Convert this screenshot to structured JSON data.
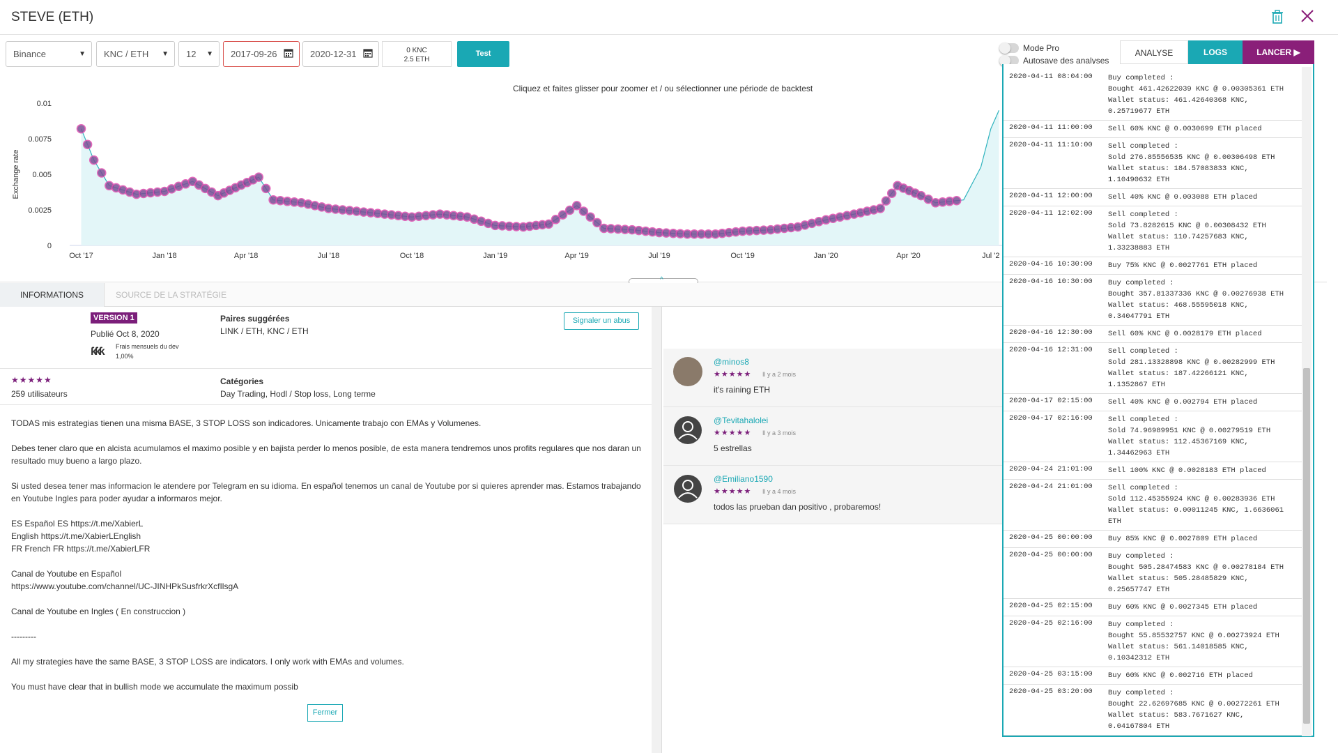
{
  "header": {
    "title": "STEVE (ETH)"
  },
  "toolbar": {
    "exchange": "Binance",
    "pair": "KNC / ETH",
    "interval": "12",
    "start_date": "2017-09-26",
    "end_date": "2020-12-31",
    "wallet_line1": "0 KNC",
    "wallet_line2": "2.5 ETH",
    "test_label": "Test",
    "mode_pro_label": "Mode Pro",
    "autosave_label": "Autosave des analyses",
    "mode_pro_on": false,
    "autosave_on": false,
    "tab_analyse": "ANALYSE",
    "tab_logs": "LOGS",
    "tab_launch": "LANCER ▶"
  },
  "chart": {
    "hint": "Cliquez et faites glisser pour zoomer et / ou sélectionner une période de backtest",
    "colors": {
      "line": "#2fb3be",
      "fill": "#e3f6f8",
      "marker": "#7b4e95",
      "marker_ring": "#e04db0"
    }
  },
  "chart_data": {
    "type": "area",
    "ylabel": "Exchange rate",
    "ylim": [
      0,
      0.01
    ],
    "yticks": [
      "0",
      "0.0025",
      "0.005",
      "0.0075",
      "0.01"
    ],
    "xticks": [
      "Oct '17",
      "Jan '18",
      "Apr '18",
      "Jul '18",
      "Oct '18",
      "Jan '19",
      "Apr '19",
      "Jul '19",
      "Oct '19",
      "Jan '20",
      "Apr '20",
      "Jul '2"
    ],
    "x_dates": [
      "2017-10-01",
      "2017-10-15",
      "2017-11-01",
      "2017-12-01",
      "2018-01-01",
      "2018-02-01",
      "2018-03-01",
      "2018-04-15",
      "2018-05-01",
      "2018-06-01",
      "2018-07-01",
      "2018-08-01",
      "2018-09-01",
      "2018-10-01",
      "2018-11-01",
      "2018-12-01",
      "2019-01-01",
      "2019-02-01",
      "2019-03-01",
      "2019-04-01",
      "2019-05-01",
      "2019-06-01",
      "2019-07-01",
      "2019-08-01",
      "2019-09-01",
      "2019-10-01",
      "2019-11-01",
      "2019-12-01",
      "2020-01-01",
      "2020-02-01",
      "2020-03-01",
      "2020-03-20",
      "2020-04-15",
      "2020-05-01",
      "2020-06-01",
      "2020-06-20",
      "2020-07-01",
      "2020-07-10"
    ],
    "values": [
      0.0082,
      0.006,
      0.0042,
      0.0036,
      0.0038,
      0.0045,
      0.0035,
      0.0048,
      0.0032,
      0.003,
      0.0026,
      0.0024,
      0.0022,
      0.002,
      0.0022,
      0.002,
      0.0014,
      0.0013,
      0.0015,
      0.0028,
      0.0012,
      0.0011,
      0.0009,
      0.0008,
      0.0008,
      0.001,
      0.0011,
      0.0013,
      0.0018,
      0.0022,
      0.0026,
      0.0042,
      0.0035,
      0.003,
      0.0032,
      0.0055,
      0.0082,
      0.0095
    ],
    "markers_note": "buy (B) / sell (S) trade markers along series",
    "grid": false
  },
  "info": {
    "tab_info": "INFORMATIONS",
    "tab_source": "SOURCE DE LA STRATÉGIE",
    "version_badge": "VERSION 1",
    "published": "Publié Oct 8, 2020",
    "fees_label": "Frais mensuels du dev",
    "fees_value": "1,00%",
    "suggested_pairs_label": "Paires suggérées",
    "suggested_pairs": "LINK / ETH, KNC / ETH",
    "report_button": "Signaler un abus",
    "users": "259 utilisateurs",
    "categories_label": "Catégories",
    "categories": "Day Trading, Hodl / Stop loss, Long terme",
    "description": [
      "TODAS mis estrategias tienen una misma BASE, 3 STOP LOSS son indicadores. Unicamente trabajo con EMAs y Volumenes.",
      "Debes tener claro que en alcista acumulamos el maximo posible y en bajista perder lo menos posible, de esta manera tendremos unos profits regulares que nos daran un",
      "resultado muy bueno a largo plazo.",
      "Si usted desea tener mas informacion le atendere por Telegram en su idioma. En español tenemos un canal de Youtube por si quieres aprender mas. Estamos trabajando",
      "en Youtube Ingles para poder ayudar a informaros mejor.",
      "ES Español ES https://t.me/XabierL",
      "English https://t.me/XabierLEnglish",
      "FR French FR https://t.me/XabierLFR",
      "Canal de Youtube en Español",
      "https://www.youtube.com/channel/UC-JINHPkSusfrkrXcfIlsgA",
      "Canal de Youtube en Ingles ( En construccion )",
      "---------",
      "All my strategies have the same BASE, 3 STOP LOSS are indicators. I only work with EMAs and volumes.",
      "You must have clear that in bullish mode we accumulate the maximum possib"
    ],
    "close_button": "Fermer"
  },
  "comments": [
    {
      "user": "@minos8",
      "when": "Il y a 2 mois",
      "text": "it's raining ETH"
    },
    {
      "user": "@Tevitahalolei",
      "when": "Il y a 3 mois",
      "text": "5 estrellas"
    },
    {
      "user": "@Emiliano1590",
      "when": "Il y a 4 mois",
      "text": "todos las prueban dan positivo , probaremos!"
    }
  ],
  "logs": [
    {
      "ts": "2020-04-11 08:04:00",
      "msg": "Buy completed :\nBought 461.42622039 KNC @ 0.00305361 ETH\nWallet status: 461.42640368 KNC,\n0.25719677 ETH"
    },
    {
      "ts": "2020-04-11 11:00:00",
      "msg": "Sell 60% KNC @ 0.0030699 ETH placed"
    },
    {
      "ts": "2020-04-11 11:10:00",
      "msg": "Sell completed :\nSold 276.85556535 KNC @ 0.00306498 ETH\nWallet status: 184.57083833 KNC,\n1.10490632 ETH"
    },
    {
      "ts": "2020-04-11 12:00:00",
      "msg": "Sell 40% KNC @ 0.003088 ETH placed"
    },
    {
      "ts": "2020-04-11 12:02:00",
      "msg": "Sell completed :\nSold 73.8282615 KNC @ 0.00308432 ETH\nWallet status: 110.74257683 KNC,\n1.33238883 ETH"
    },
    {
      "ts": "2020-04-16 10:30:00",
      "msg": "Buy 75% KNC @ 0.0027761 ETH placed"
    },
    {
      "ts": "2020-04-16 10:30:00",
      "msg": "Buy completed :\nBought 357.81337336 KNC @ 0.00276938 ETH\nWallet status: 468.55595018 KNC,\n0.34047791 ETH"
    },
    {
      "ts": "2020-04-16 12:30:00",
      "msg": "Sell 60% KNC @ 0.0028179 ETH placed"
    },
    {
      "ts": "2020-04-16 12:31:00",
      "msg": "Sell completed :\nSold 281.13328898 KNC @ 0.00282999 ETH\nWallet status: 187.42266121 KNC,\n1.1352867 ETH"
    },
    {
      "ts": "2020-04-17 02:15:00",
      "msg": "Sell 40% KNC @ 0.002794 ETH placed"
    },
    {
      "ts": "2020-04-17 02:16:00",
      "msg": "Sell completed :\nSold 74.96989951 KNC @ 0.00279519 ETH\nWallet status: 112.45367169 KNC,\n1.34462963 ETH"
    },
    {
      "ts": "2020-04-24 21:01:00",
      "msg": "Sell 100% KNC @ 0.0028183 ETH placed"
    },
    {
      "ts": "2020-04-24 21:01:00",
      "msg": "Sell completed :\nSold 112.45355924 KNC @ 0.00283936 ETH\nWallet status: 0.00011245 KNC, 1.6636061\nETH"
    },
    {
      "ts": "2020-04-25 00:00:00",
      "msg": "Buy 85% KNC @ 0.0027809 ETH placed"
    },
    {
      "ts": "2020-04-25 00:00:00",
      "msg": "Buy completed :\nBought 505.28474583 KNC @ 0.00278184 ETH\nWallet status: 505.28485829 KNC,\n0.25657747 ETH"
    },
    {
      "ts": "2020-04-25 02:15:00",
      "msg": "Buy 60% KNC @ 0.0027345 ETH placed"
    },
    {
      "ts": "2020-04-25 02:16:00",
      "msg": "Buy completed :\nBought 55.85532757 KNC @ 0.00273924 ETH\nWallet status: 561.14018585 KNC,\n0.10342312 ETH"
    },
    {
      "ts": "2020-04-25 03:15:00",
      "msg": "Buy 60% KNC @ 0.002716 ETH placed"
    },
    {
      "ts": "2020-04-25 03:20:00",
      "msg": "Buy completed :\nBought 22.62697685 KNC @ 0.00272261 ETH\nWallet status: 583.7671627 KNC,\n0.04167804 ETH"
    }
  ]
}
